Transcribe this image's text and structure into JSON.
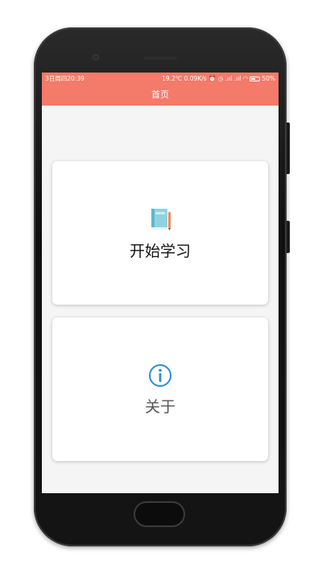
{
  "status_bar": {
    "left_text": "3日周四20:39",
    "right_text": "19.2℃ 0.09K/s ⏰ ◷ .ııl .ııl ◠",
    "battery_text": "50%"
  },
  "header": {
    "title": "首页"
  },
  "cards": {
    "study": {
      "label": "开始学习",
      "icon": "book-icon"
    },
    "about": {
      "label": "关于",
      "icon": "info-icon"
    }
  },
  "colors": {
    "accent": "#f47a6a",
    "info_blue": "#2a8fd0"
  }
}
